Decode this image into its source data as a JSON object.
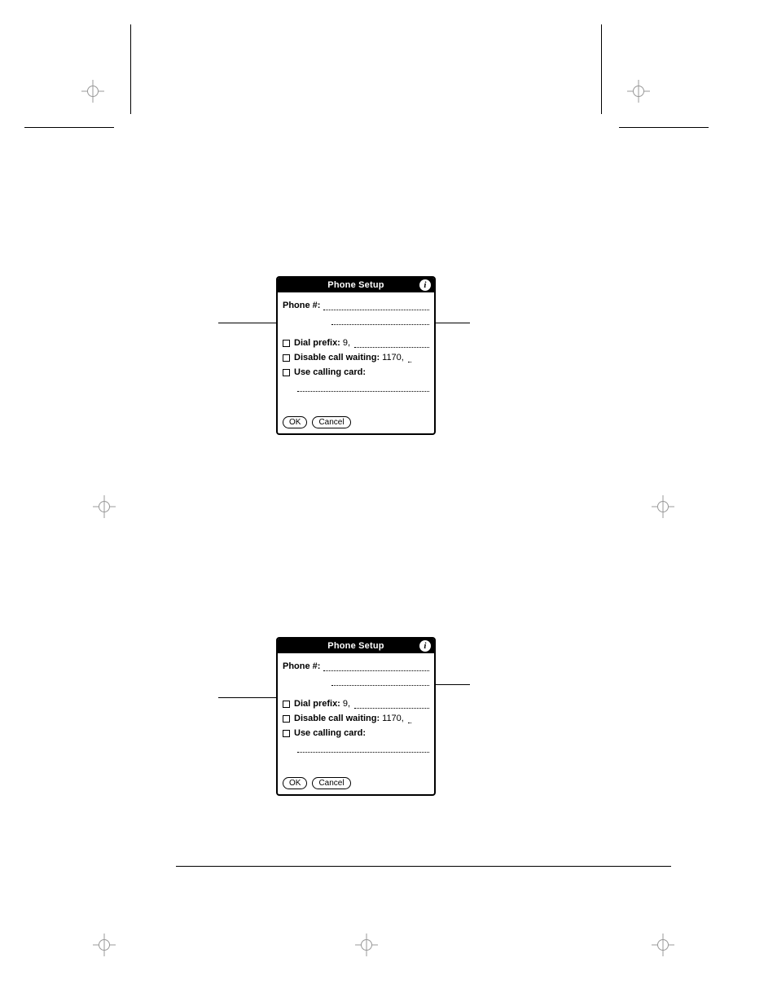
{
  "dialog": {
    "title": "Phone Setup",
    "info_glyph": "i",
    "phone_label": "Phone #:",
    "dial_prefix_label": "Dial prefix:",
    "dial_prefix_value": "9,",
    "disable_cw_label": "Disable call waiting:",
    "disable_cw_value": "1170,",
    "calling_card_label": "Use calling card:",
    "ok_label": "OK",
    "cancel_label": "Cancel"
  }
}
